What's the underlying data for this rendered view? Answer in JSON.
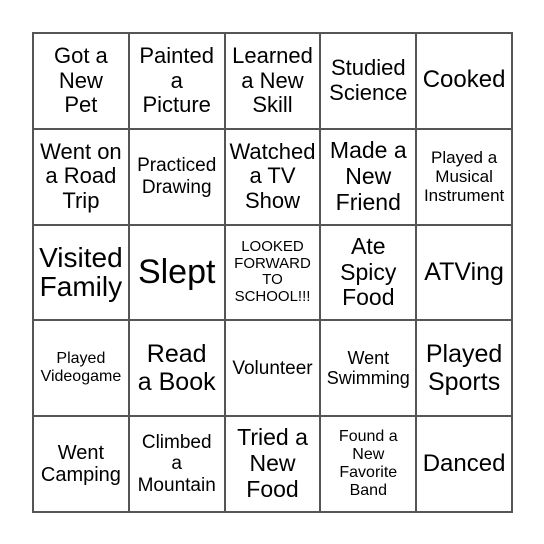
{
  "board": {
    "cells": [
      "Got a\nNew\nPet",
      "Painted\na\nPicture",
      "Learned\na New\nSkill",
      "Studied\nScience",
      "Cooked",
      "Went on\na Road\nTrip",
      "Practiced\nDrawing",
      "Watched\na TV\nShow",
      "Made a\nNew\nFriend",
      "Played a\nMusical\nInstrument",
      "Visited\nFamily",
      "Slept",
      "LOOKED\nFORWARD\nTO\nSCHOOL!!!",
      "Ate\nSpicy\nFood",
      "ATVing",
      "Played\nVideogame",
      "Read\na Book",
      "Volunteer",
      "Went\nSwimming",
      "Played\nSports",
      "Went\nCamping",
      "Climbed\na\nMountain",
      "Tried a\nNew\nFood",
      "Found a\nNew\nFavorite\nBand",
      "Danced"
    ]
  }
}
